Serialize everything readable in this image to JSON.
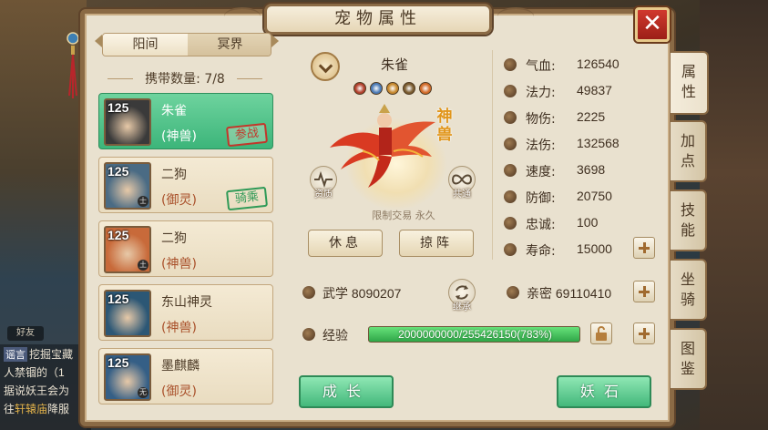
{
  "window": {
    "title": "宠物属性"
  },
  "segments": {
    "active": "阳间",
    "inactive": "冥界"
  },
  "carry": {
    "label": "携带数量:",
    "count": "7/8"
  },
  "pets": [
    {
      "level": "125",
      "name": "朱雀",
      "type": "(神兽)",
      "stamp": "参战",
      "stamp_color": "red",
      "selected": true,
      "bg": "#3a3a3a"
    },
    {
      "level": "125",
      "name": "二狗",
      "type": "(御灵)",
      "stamp": "骑乘",
      "stamp_color": "green",
      "selected": false,
      "bg": "#4a6b84",
      "tag": "士"
    },
    {
      "level": "125",
      "name": "二狗",
      "type": "(神兽)",
      "stamp": "",
      "stamp_color": "",
      "selected": false,
      "bg": "#c86a3a",
      "tag": "土"
    },
    {
      "level": "125",
      "name": "东山神灵",
      "type": "(神兽)",
      "stamp": "",
      "stamp_color": "",
      "selected": false,
      "bg": "#2c5775"
    },
    {
      "level": "125",
      "name": "墨麒麟",
      "type": "(御灵)",
      "stamp": "",
      "stamp_color": "",
      "selected": false,
      "bg": "#355f86",
      "tag": "无"
    }
  ],
  "current_pet": {
    "name": "朱雀",
    "vertical_label": "神兽",
    "restrict_text": "限制交易 永久",
    "qualify_label": "资质",
    "share_label": "共通",
    "inherit_label": "继承",
    "skill_colors": [
      "#b2402c",
      "#4c7bb6",
      "#c7892f",
      "#7a5b2f",
      "#d26b2a"
    ]
  },
  "actions": {
    "rest": "休息",
    "formation": "掠阵",
    "grow": "成长",
    "demon_stone": "妖石"
  },
  "stats": [
    {
      "icon": "qixue-icon",
      "label": "气血:",
      "value": "126540"
    },
    {
      "icon": "fali-icon",
      "label": "法力:",
      "value": "49837"
    },
    {
      "icon": "wushang-icon",
      "label": "物伤:",
      "value": "2225"
    },
    {
      "icon": "fashang-icon",
      "label": "法伤:",
      "value": "132568"
    },
    {
      "icon": "sudu-icon",
      "label": "速度:",
      "value": "3698"
    },
    {
      "icon": "fangyu-icon",
      "label": "防御:",
      "value": "20750"
    },
    {
      "icon": "zhongcheng-icon",
      "label": "忠诚:",
      "value": "100"
    },
    {
      "icon": "shouming-icon",
      "label": "寿命:",
      "value": "15000"
    }
  ],
  "wuxue": {
    "label": "武学",
    "value": "8090207"
  },
  "qinmi": {
    "label": "亲密",
    "value": "69110410"
  },
  "exp": {
    "label": "经验",
    "text": "2000000000/255426150(783%)",
    "fill_fraction": 1.0
  },
  "side_tabs": [
    "属性",
    "加点",
    "技能",
    "坐骑",
    "图鉴"
  ],
  "background": {
    "friend": "好友",
    "chat": [
      {
        "tag": "谣言",
        "text": "挖掘宝藏"
      },
      {
        "text": "人禁锢的（1"
      },
      {
        "text": "据说妖王会为"
      },
      {
        "text": "往",
        "hl": "轩辕庙",
        "tail": "降服"
      }
    ]
  }
}
